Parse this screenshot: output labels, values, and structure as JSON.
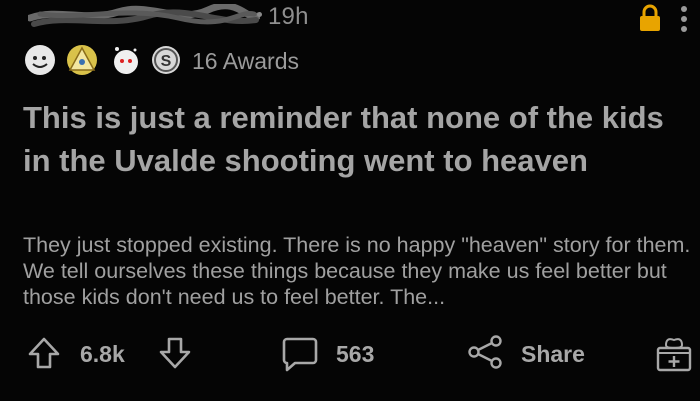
{
  "header": {
    "time": "19h",
    "icons": [
      "lock-icon",
      "more-vertical-icon"
    ],
    "lock_color": "#e8a400"
  },
  "awards": {
    "icons": [
      "wholesome-award-icon",
      "helpful-award-icon",
      "heartwarming-award-icon",
      "silver-award-icon"
    ],
    "count_label": "16 Awards"
  },
  "post": {
    "title": "This is just a reminder that none of the kids in the Uvalde shooting went to heaven",
    "body": "They just stopped existing. There is no happy \"heaven\" story for them. We tell ourselves these things because they make us feel better but those kids don't need us to feel better. The..."
  },
  "actions": {
    "vote_count": "6.8k",
    "comment_count": "563",
    "share_label": "Share"
  }
}
